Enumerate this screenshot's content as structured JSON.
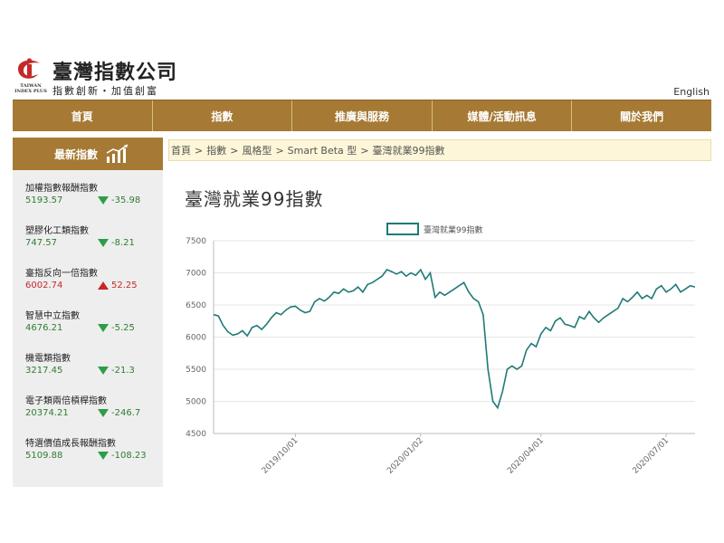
{
  "brand": {
    "name": "臺灣指數公司",
    "slogan": "指數創新・加值創富",
    "mini_logo": "TAIWAN INDEX PLUS",
    "lang_link": "English",
    "logo_color": "#c62828"
  },
  "nav": {
    "items": [
      "首頁",
      "指數",
      "推廣與服務",
      "媒體/活動訊息",
      "關於我們"
    ]
  },
  "sidebar": {
    "title": "最新指數",
    "items": [
      {
        "name": "加權指數報酬指數",
        "value": "5193.57",
        "change": "-35.98",
        "dir": "down"
      },
      {
        "name": "塑膠化工類指數",
        "value": "747.57",
        "change": "-8.21",
        "dir": "down"
      },
      {
        "name": "臺指反向一倍指數",
        "value": "6002.74",
        "change": "52.25",
        "dir": "up"
      },
      {
        "name": "智慧中立指數",
        "value": "4676.21",
        "change": "-5.25",
        "dir": "down"
      },
      {
        "name": "機電類指數",
        "value": "3217.45",
        "change": "-21.3",
        "dir": "down"
      },
      {
        "name": "電子類兩倍槓桿指數",
        "value": "20374.21",
        "change": "-246.7",
        "dir": "down"
      },
      {
        "name": "特選價值成長報酬指數",
        "value": "5109.88",
        "change": "-108.23",
        "dir": "down"
      }
    ]
  },
  "breadcrumb": {
    "items": [
      "首頁",
      "指數",
      "風格型",
      "Smart Beta 型",
      "臺灣就業99指數"
    ],
    "separator": ">"
  },
  "page": {
    "title": "臺灣就業99指數"
  },
  "colors": {
    "accent": "#a67a34",
    "line": "#1f7a76",
    "up": "#c62828",
    "down": "#2e9d48"
  },
  "chart_data": {
    "type": "line",
    "title": "",
    "xlabel": "",
    "ylabel": "",
    "ylim": [
      4500,
      7500
    ],
    "yticks": [
      4500,
      5000,
      5500,
      6000,
      6500,
      7000,
      7500
    ],
    "xticks": [
      "2019/10/01",
      "2020/01/02",
      "2020/04/01",
      "2020/07/01"
    ],
    "xtick_positions": [
      0.17,
      0.43,
      0.68,
      0.94
    ],
    "legend": "top-center",
    "grid": true,
    "series": [
      {
        "name": "臺灣就業99指數",
        "x": [
          0,
          0.01,
          0.02,
          0.03,
          0.04,
          0.05,
          0.06,
          0.07,
          0.08,
          0.09,
          0.1,
          0.11,
          0.12,
          0.13,
          0.14,
          0.15,
          0.16,
          0.17,
          0.18,
          0.19,
          0.2,
          0.21,
          0.22,
          0.23,
          0.24,
          0.25,
          0.26,
          0.27,
          0.28,
          0.29,
          0.3,
          0.31,
          0.32,
          0.33,
          0.34,
          0.35,
          0.36,
          0.37,
          0.38,
          0.39,
          0.4,
          0.41,
          0.42,
          0.43,
          0.44,
          0.45,
          0.46,
          0.47,
          0.48,
          0.49,
          0.5,
          0.51,
          0.52,
          0.53,
          0.54,
          0.55,
          0.56,
          0.57,
          0.58,
          0.59,
          0.6,
          0.61,
          0.62,
          0.63,
          0.64,
          0.65,
          0.66,
          0.67,
          0.68,
          0.69,
          0.7,
          0.71,
          0.72,
          0.73,
          0.74,
          0.75,
          0.76,
          0.77,
          0.78,
          0.79,
          0.8,
          0.81,
          0.82,
          0.83,
          0.84,
          0.85,
          0.86,
          0.87,
          0.88,
          0.89,
          0.9,
          0.91,
          0.92,
          0.93,
          0.94,
          0.95,
          0.96,
          0.97,
          0.98,
          0.99,
          1.0
        ],
        "values": [
          6350,
          6330,
          6180,
          6080,
          6030,
          6050,
          6100,
          6020,
          6150,
          6180,
          6120,
          6200,
          6300,
          6380,
          6350,
          6420,
          6470,
          6480,
          6420,
          6380,
          6400,
          6550,
          6600,
          6560,
          6620,
          6700,
          6680,
          6750,
          6700,
          6720,
          6780,
          6700,
          6820,
          6850,
          6900,
          6950,
          7050,
          7020,
          6980,
          7020,
          6950,
          7000,
          6960,
          7050,
          6900,
          7000,
          6620,
          6700,
          6650,
          6700,
          6750,
          6800,
          6850,
          6700,
          6600,
          6550,
          6350,
          5500,
          5000,
          4900,
          5150,
          5500,
          5550,
          5500,
          5550,
          5800,
          5900,
          5850,
          6050,
          6150,
          6100,
          6250,
          6300,
          6200,
          6180,
          6150,
          6320,
          6280,
          6400,
          6300,
          6230,
          6300,
          6350,
          6400,
          6450,
          6600,
          6550,
          6620,
          6700,
          6600,
          6650,
          6600,
          6750,
          6800,
          6700,
          6750,
          6820,
          6700,
          6750,
          6800,
          6780
        ]
      }
    ]
  }
}
